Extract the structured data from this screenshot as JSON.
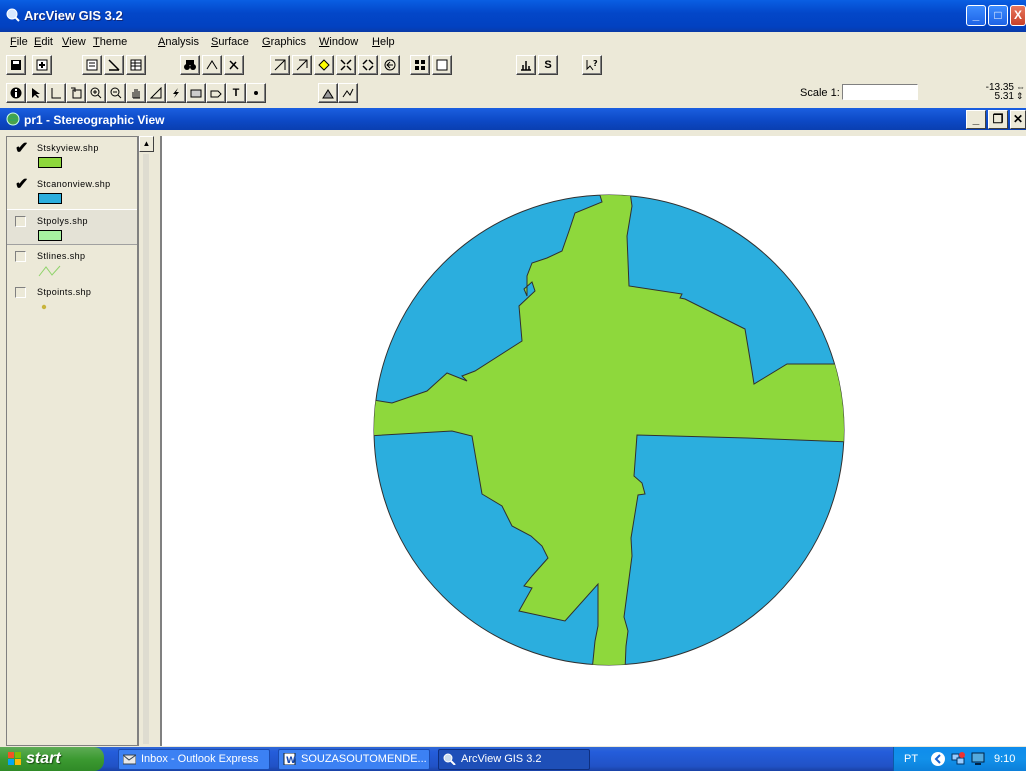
{
  "app": {
    "title": "ArcView GIS 3.2"
  },
  "menu": [
    "File",
    "Edit",
    "View",
    "Theme",
    "Analysis",
    "Surface",
    "Graphics",
    "Window",
    "Help"
  ],
  "toolbar2": {
    "scale_label": "Scale 1:",
    "scale_value": "",
    "coord_x": "-13.35",
    "coord_y": "5.31"
  },
  "view": {
    "title": "pr1 - Stereographic View"
  },
  "toc": {
    "themes": [
      {
        "name": "Stskyview.shp",
        "checked": true,
        "symbol": "polygon",
        "color": "#8ed83c"
      },
      {
        "name": "Stcanonview.shp",
        "checked": true,
        "symbol": "polygon",
        "color": "#2baede"
      },
      {
        "name": "Stpolys.shp",
        "checked": false,
        "symbol": "polygon",
        "color": "#a6f2a0"
      },
      {
        "name": "Stlines.shp",
        "checked": false,
        "symbol": "line",
        "color": "#8fd36a"
      },
      {
        "name": "Stpoints.shp",
        "checked": false,
        "symbol": "point",
        "color": "#c8b43c"
      }
    ]
  },
  "map": {
    "canopy_color": "#2baede",
    "sky_color": "#8ed83c"
  },
  "taskbar": {
    "start_label": "start",
    "tasks": [
      "Inbox - Outlook Express",
      "SOUZASOUTOMENDE...",
      "ArcView GIS 3.2"
    ],
    "language": "PT",
    "clock": "9:10"
  }
}
